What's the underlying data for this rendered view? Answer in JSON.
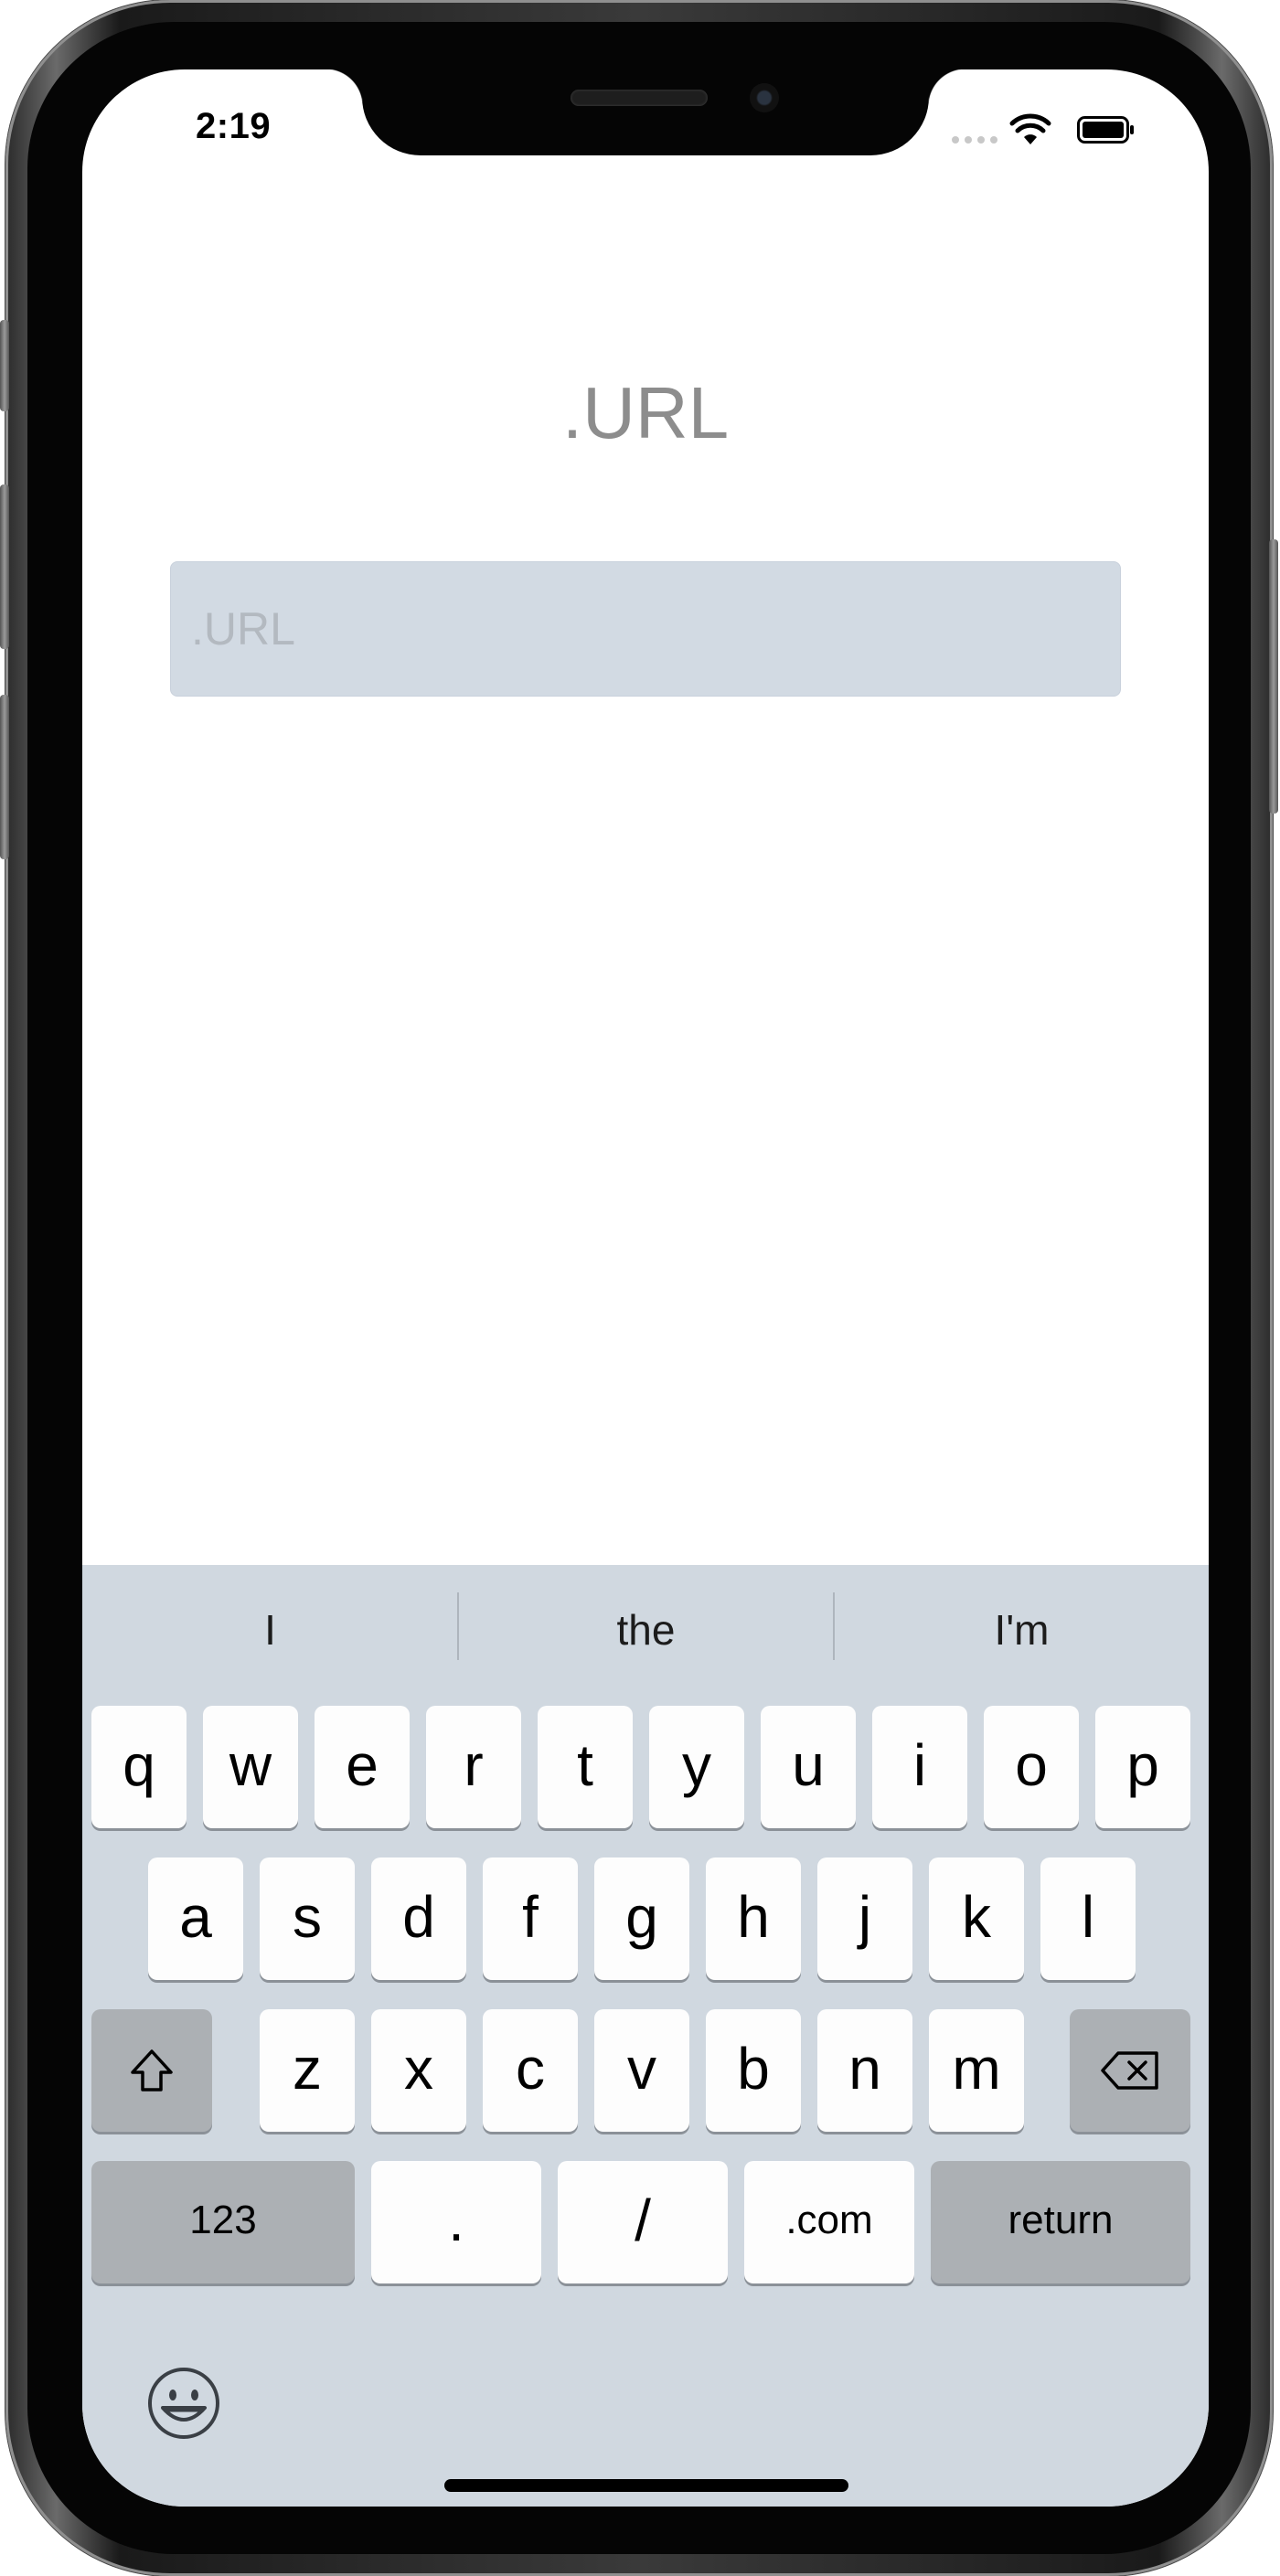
{
  "status_bar": {
    "time": "2:19"
  },
  "screen": {
    "title": ".URL",
    "url_field": {
      "value": "",
      "placeholder": ".URL"
    }
  },
  "keyboard": {
    "predictions": [
      "I",
      "the",
      "I'm"
    ],
    "row1": [
      "q",
      "w",
      "e",
      "r",
      "t",
      "y",
      "u",
      "i",
      "o",
      "p"
    ],
    "row2": [
      "a",
      "s",
      "d",
      "f",
      "g",
      "h",
      "j",
      "k",
      "l"
    ],
    "row3": [
      "z",
      "x",
      "c",
      "v",
      "b",
      "n",
      "m"
    ],
    "bottom_row": {
      "numbers": "123",
      "dot": ".",
      "slash": "/",
      "dotcom": ".com",
      "return": "return"
    },
    "icons": {
      "shift": "shift-icon",
      "delete": "delete-icon",
      "emoji": "emoji-icon"
    }
  },
  "colors": {
    "keyboard_background": "#d0d8e0",
    "key_light": "#fdfdfd",
    "key_dark": "#acb0b4",
    "input_background": "#d2dae3",
    "title_text": "#8d8d8d"
  }
}
